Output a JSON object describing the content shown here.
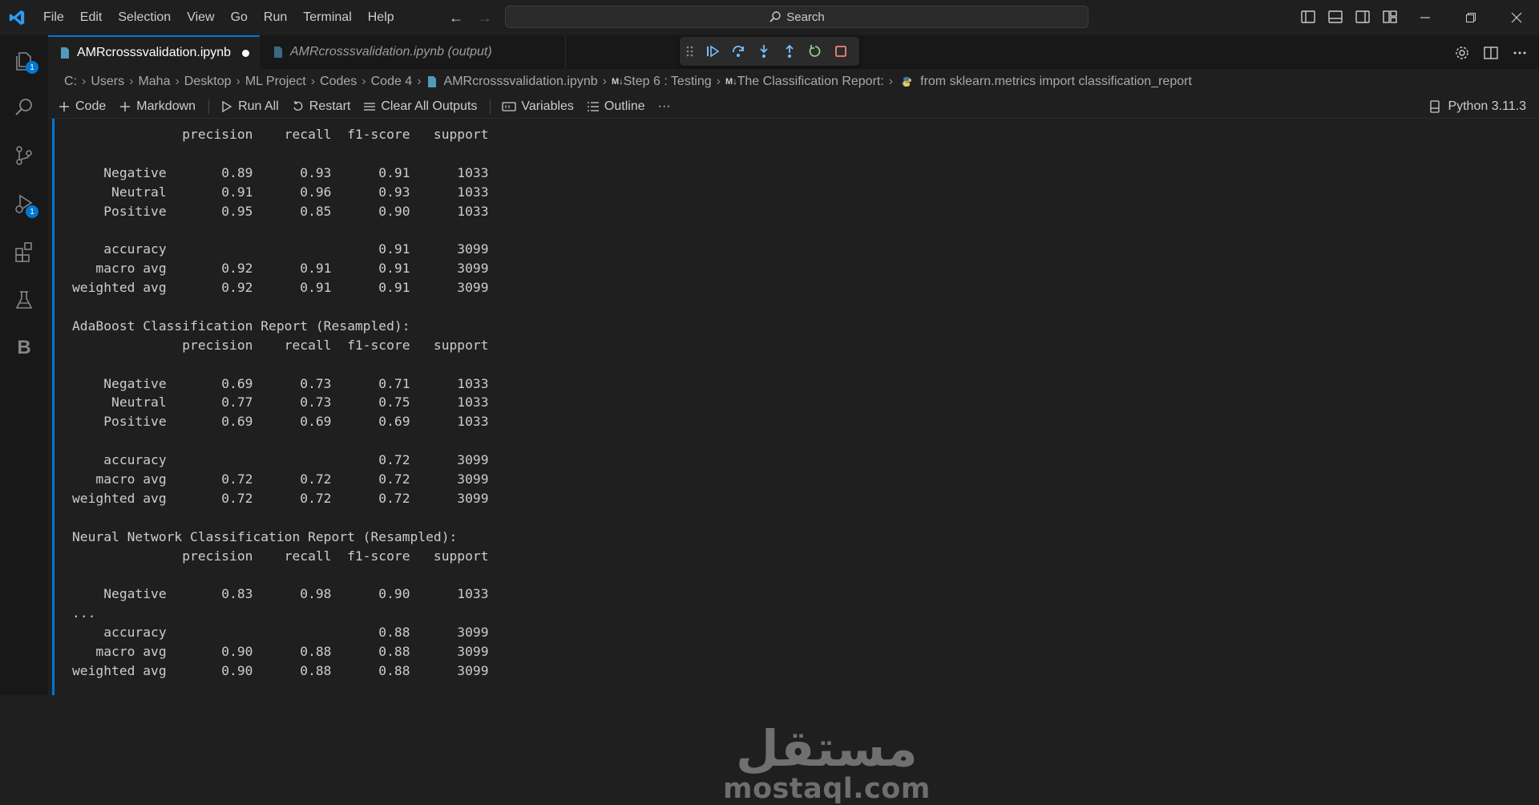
{
  "menu": [
    "File",
    "Edit",
    "Selection",
    "View",
    "Go",
    "Run",
    "Terminal",
    "Help"
  ],
  "search": {
    "label": "Search"
  },
  "activity": {
    "explorer_badge": "1",
    "debug_badge": "1",
    "b_label": "B"
  },
  "tabs": [
    {
      "label": "AMRcrosssvalidation.ipynb",
      "modified": true
    },
    {
      "label": "AMRcrosssvalidation.ipynb (output)"
    }
  ],
  "breadcrumb": [
    "C:",
    "Users",
    "Maha",
    "Desktop",
    "ML Project",
    "Codes",
    "Code 4",
    "AMRcrosssvalidation.ipynb",
    "Step 6 : Testing",
    "The Classification Report:",
    "from sklearn.metrics import classification_report"
  ],
  "toolbar": {
    "code": "Code",
    "markdown": "Markdown",
    "run_all": "Run All",
    "restart": "Restart",
    "clear": "Clear All Outputs",
    "variables": "Variables",
    "outline": "Outline",
    "more": "···",
    "kernel": "Python 3.11.3"
  },
  "output_lines": [
    "              precision    recall  f1-score   support",
    "",
    "    Negative       0.89      0.93      0.91      1033",
    "     Neutral       0.91      0.96      0.93      1033",
    "    Positive       0.95      0.85      0.90      1033",
    "",
    "    accuracy                           0.91      3099",
    "   macro avg       0.92      0.91      0.91      3099",
    "weighted avg       0.92      0.91      0.91      3099",
    "",
    "AdaBoost Classification Report (Resampled):",
    "              precision    recall  f1-score   support",
    "",
    "    Negative       0.69      0.73      0.71      1033",
    "     Neutral       0.77      0.73      0.75      1033",
    "    Positive       0.69      0.69      0.69      1033",
    "",
    "    accuracy                           0.72      3099",
    "   macro avg       0.72      0.72      0.72      3099",
    "weighted avg       0.72      0.72      0.72      3099",
    "",
    "Neural Network Classification Report (Resampled):",
    "              precision    recall  f1-score   support",
    "",
    "    Negative       0.83      0.98      0.90      1033",
    "...",
    "    accuracy                           0.88      3099",
    "   macro avg       0.90      0.88      0.88      3099",
    "weighted avg       0.90      0.88      0.88      3099"
  ],
  "watermark": {
    "arabic": "مستقل",
    "latin": "mostaql.com"
  },
  "colors": {
    "accent": "#0078d4",
    "background": "#1f1f1f",
    "sidebar": "#181818"
  }
}
